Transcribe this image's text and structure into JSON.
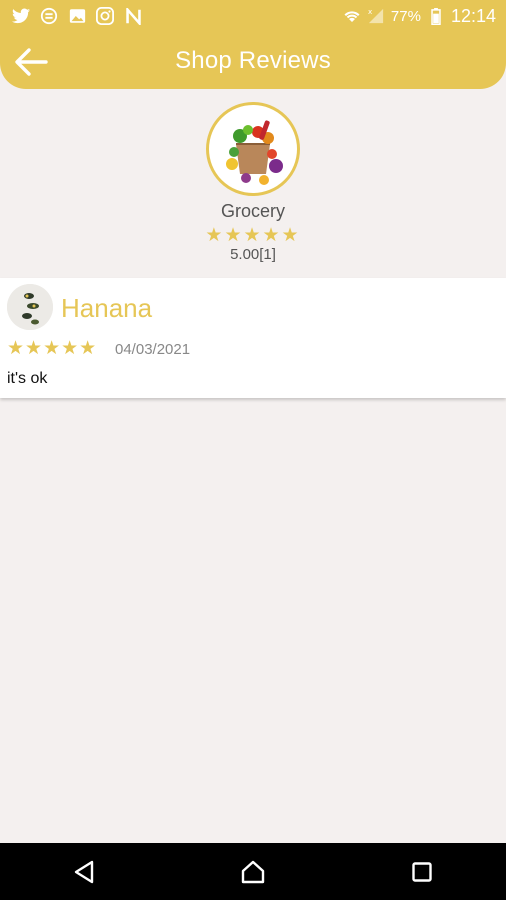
{
  "status_bar": {
    "battery_percent": "77%",
    "time": "12:14",
    "icons": [
      "twitter-icon",
      "sync-icon",
      "image-icon",
      "instagram-icon",
      "n-app-icon",
      "wifi-icon",
      "signal-icon",
      "battery-icon"
    ]
  },
  "header": {
    "title": "Shop Reviews",
    "back_icon": "arrow-left-icon"
  },
  "shop": {
    "name": "Grocery",
    "stars": "★★★★★",
    "rating": 5.0,
    "rating_label": "5.00[1]"
  },
  "reviews": [
    {
      "name": "Hanana",
      "stars": "★★★★★",
      "rating": 5,
      "date": "04/03/2021",
      "text": "it's ok"
    }
  ],
  "nav": {
    "back_icon": "triangle-back-icon",
    "home_icon": "circle-home-icon",
    "recents_icon": "square-recents-icon"
  },
  "colors": {
    "accent": "#e6c656",
    "background": "#f4f0ef",
    "card": "#ffffff",
    "navbar": "#000000"
  }
}
